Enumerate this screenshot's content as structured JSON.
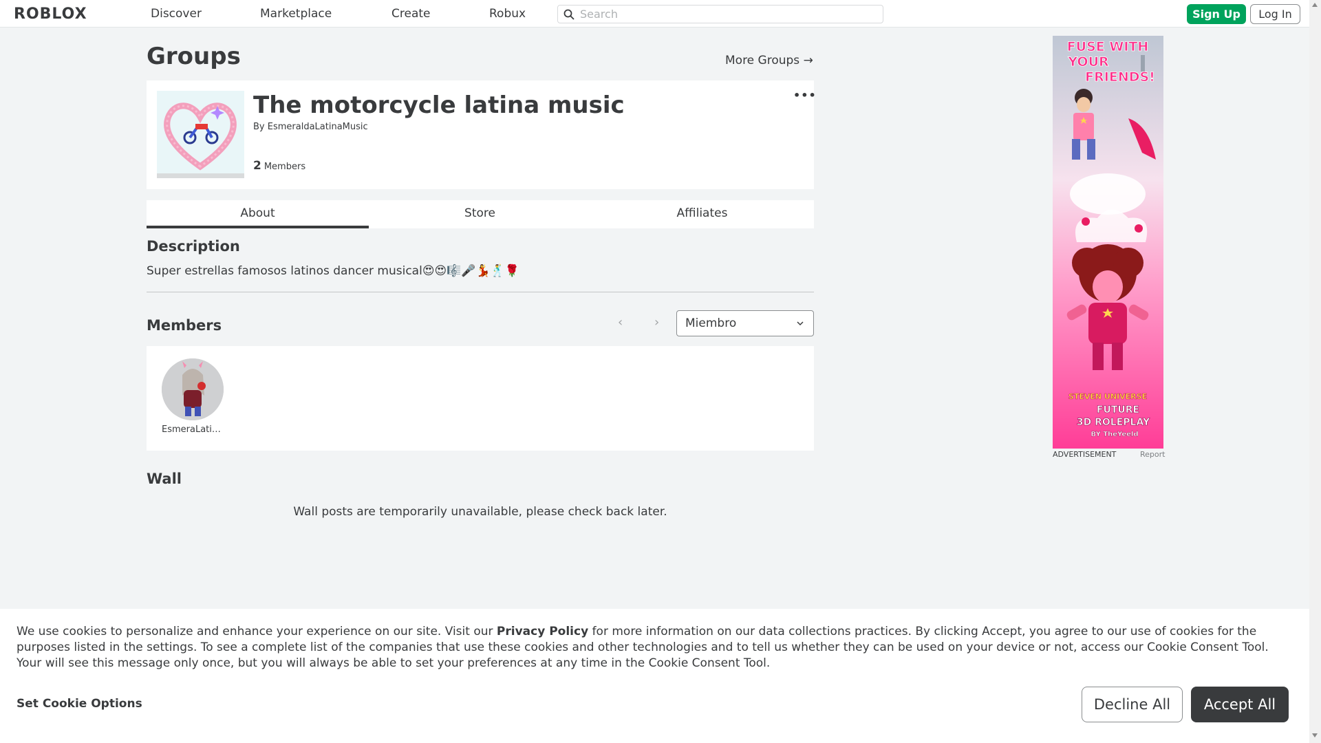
{
  "nav": {
    "logo": "ROBLOX",
    "links": [
      "Discover",
      "Marketplace",
      "Create",
      "Robux"
    ],
    "search_placeholder": "Search",
    "signup_label": "Sign Up",
    "login_label": "Log In"
  },
  "page": {
    "title": "Groups",
    "more_groups": "More Groups →"
  },
  "group": {
    "name": "The motorcycle latina music",
    "by_prefix": "By",
    "owner": "EsmeraldaLatinaMusic",
    "member_count": "2",
    "members_label": "Members",
    "menu_dots": "•••"
  },
  "tabs": [
    "About",
    "Store",
    "Affiliates"
  ],
  "about": {
    "description_heading": "Description",
    "description_text": "Super estrellas famosos latinos dancer musical😍😍🎼🎤💃🕺🌹"
  },
  "members": {
    "heading": "Members",
    "prev": "‹",
    "next": "›",
    "role_selected": "Miembro",
    "list": [
      {
        "name": "EsmeraLatin..."
      }
    ]
  },
  "wall": {
    "heading": "Wall",
    "message": "Wall posts are temporarily unavailable, please check back later."
  },
  "ad": {
    "headline_1": "FUSE WITH",
    "headline_2": "YOUR",
    "headline_3": "FRIENDS!",
    "brand_1": "STEVEN UNIVERSE",
    "brand_2": "FUTURE",
    "brand_3": "3D ROLEPLAY",
    "brand_4": "BY TheYeeld",
    "label": "ADVERTISEMENT",
    "report": "Report"
  },
  "cookie": {
    "text_before": "We use cookies to personalize and enhance your experience on our site. Visit our ",
    "privacy_link": "Privacy Policy",
    "text_after": " for more information on our data collections practices. By clicking Accept, you agree to our use of cookies for the purposes listed in the settings. To see a complete list of the companies that use these cookies and other technologies and to tell us whether they can be used on your device or not, access our Cookie Consent Tool. Your will see this message only once, but you will always be able to set your preferences at any time in the Cookie Consent Tool.",
    "set_options": "Set Cookie Options",
    "decline": "Decline All",
    "accept": "Accept All"
  },
  "colors": {
    "accent_green": "#00a35c",
    "text_dark": "#393b3d",
    "page_bg": "#f2f4f5",
    "ad_pink": "#ff2f8a"
  }
}
